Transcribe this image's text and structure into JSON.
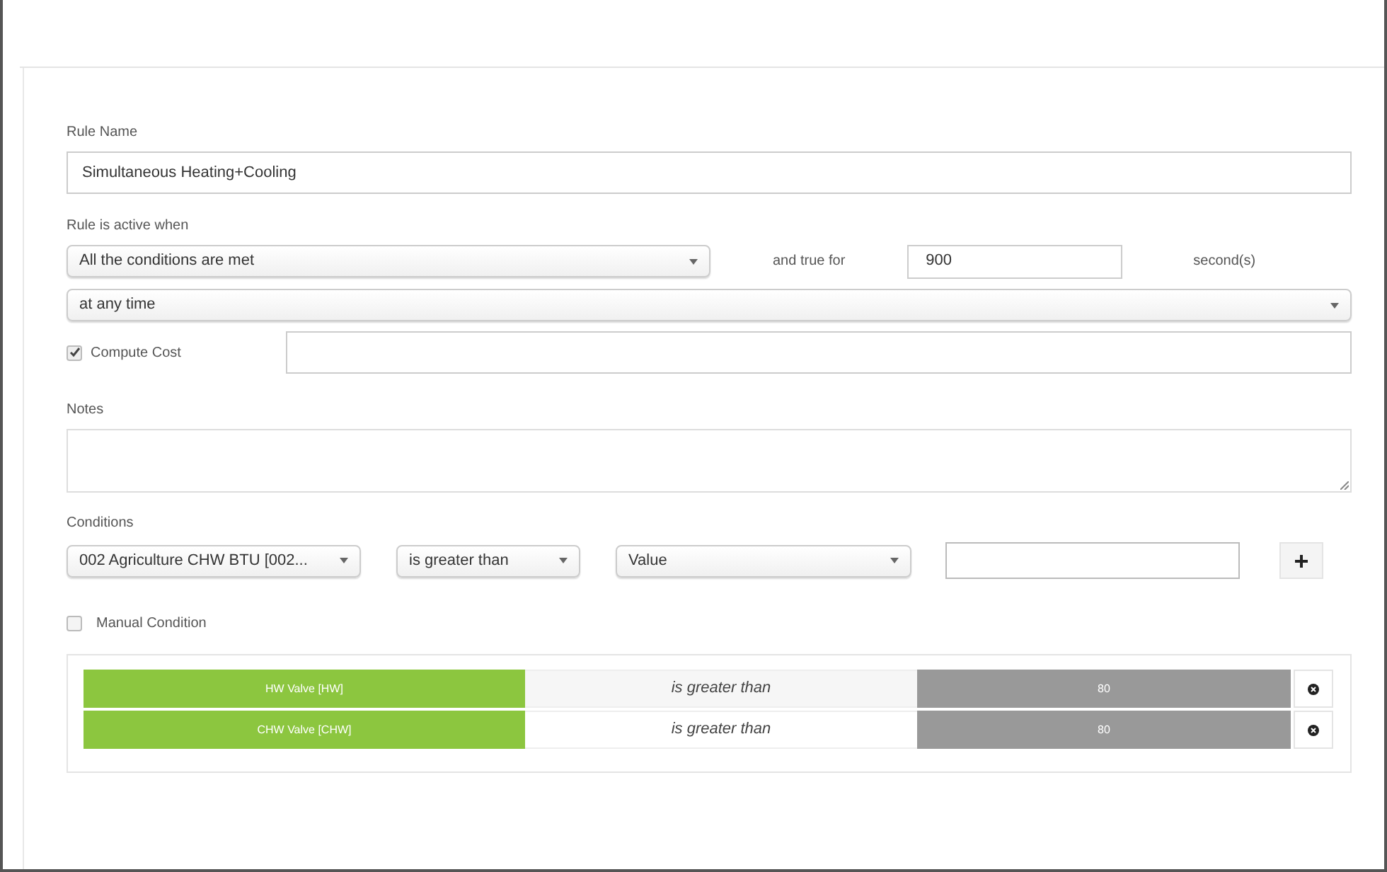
{
  "rule_name": {
    "label": "Rule Name",
    "value": "Simultaneous Heating+Cooling"
  },
  "active_when": {
    "label": "Rule is active when",
    "mode": "All the conditions are met",
    "true_for_label": "and true for",
    "duration": "900",
    "unit": "second(s)",
    "schedule": "at any time"
  },
  "compute_cost": {
    "label": "Compute Cost",
    "checked": true
  },
  "notes": {
    "label": "Notes"
  },
  "conditions": {
    "label": "Conditions",
    "point": "002 Agriculture CHW BTU [002...",
    "operator": "is greater than",
    "value_type": "Value"
  },
  "manual_condition": {
    "label": "Manual Condition",
    "checked": false
  },
  "condition_rows": [
    {
      "point": "HW Valve [HW]",
      "operator": "is greater than",
      "value": "80"
    },
    {
      "point": "CHW Valve [CHW]",
      "operator": "is greater than",
      "value": "80"
    }
  ]
}
